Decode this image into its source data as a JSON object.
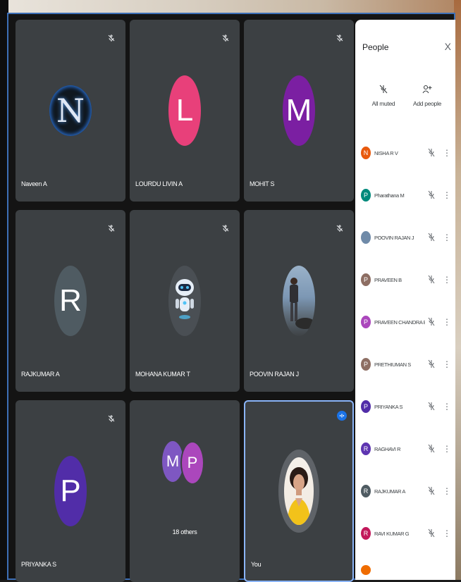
{
  "tiles": [
    {
      "name": "Naveen A",
      "initial": "N",
      "color": "#101820",
      "muted": true
    },
    {
      "name": "LOURDU LIVIN A",
      "initial": "L",
      "color": "#e8407a",
      "muted": true
    },
    {
      "name": "MOHIT S",
      "initial": "M",
      "color": "#7b1fa2",
      "muted": true
    },
    {
      "name": "RAJKUMAR A",
      "initial": "R",
      "color": "#4f5b62",
      "muted": true
    },
    {
      "name": "MOHANA KUMAR T",
      "initial": "",
      "color": "#4a4f54",
      "muted": true
    },
    {
      "name": "POOVIN RAJAN J",
      "initial": "",
      "color": "#6f8aa8",
      "muted": true
    },
    {
      "name": "PRIYANKA S",
      "initial": "P",
      "color": "#512da8",
      "muted": true
    },
    {
      "name": "",
      "initial": "",
      "color": "",
      "muted": false
    },
    {
      "name": "You",
      "initial": "",
      "color": "#5f6368",
      "muted": false
    }
  ],
  "others": {
    "initials": [
      "M",
      "P"
    ],
    "colors": [
      "#7e57c2",
      "#ab47bc"
    ],
    "label": "18 others"
  },
  "panel": {
    "title": "People",
    "close": "X",
    "all_muted": "All muted",
    "add_people": "Add people",
    "people": [
      {
        "name": "NISHA R V",
        "initial": "N",
        "color": "#e8590c"
      },
      {
        "name": "Pharathana M",
        "initial": "P",
        "color": "#00897b"
      },
      {
        "name": "POOVIN RAJAN J",
        "initial": "",
        "color": "#6f8aa8"
      },
      {
        "name": "PRAVEEN B",
        "initial": "P",
        "color": "#8d6e63"
      },
      {
        "name": "PRAVEEN CHANDRA BOS...",
        "initial": "P",
        "color": "#ab47bc"
      },
      {
        "name": "PRETHIUMAN S",
        "initial": "P",
        "color": "#8d6e63"
      },
      {
        "name": "PRIYANKA S",
        "initial": "P",
        "color": "#512da8"
      },
      {
        "name": "RAGHAVI R",
        "initial": "R",
        "color": "#5e35b1"
      },
      {
        "name": "RAJKUMAR A",
        "initial": "R",
        "color": "#4f5b62"
      },
      {
        "name": "RAVI KUMAR G",
        "initial": "R",
        "color": "#c2185b"
      }
    ]
  }
}
